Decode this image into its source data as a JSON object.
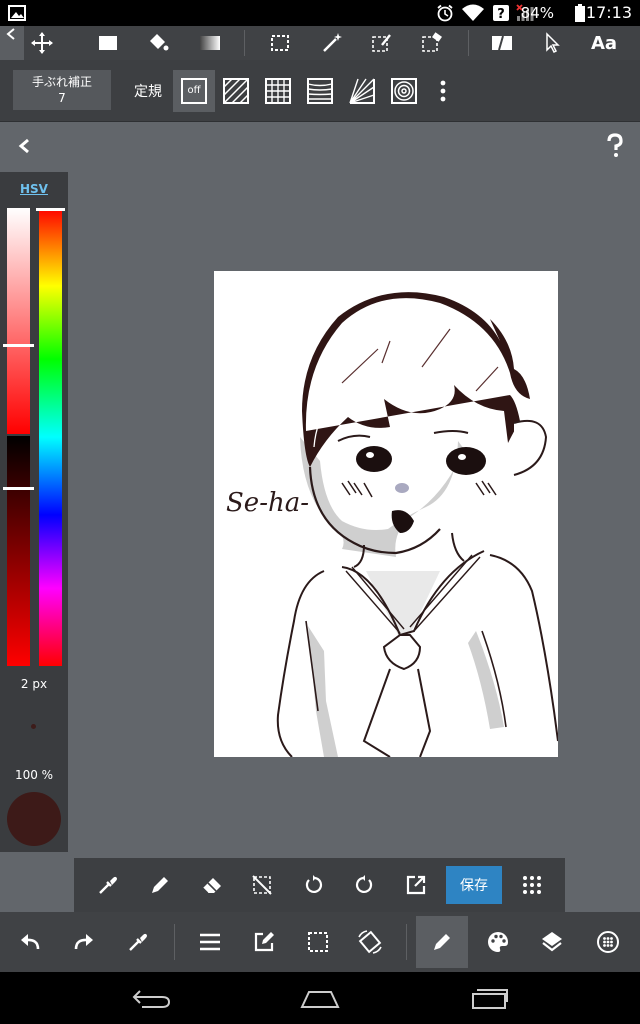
{
  "status_bar": {
    "battery": "84%",
    "time": "17:13",
    "icons": [
      "gallery-icon",
      "alarm-icon",
      "wifi-icon",
      "help-box-icon",
      "signal-off-icon",
      "battery-icon"
    ]
  },
  "top_toolbar": {
    "tools": [
      "move-icon",
      "fill-rect-icon",
      "bucket-icon",
      "gradient-icon",
      "select-rect-icon",
      "magic-wand-icon",
      "select-pen-icon",
      "select-eraser-icon",
      "frame-divider-icon",
      "pointer-icon",
      "text-icon"
    ],
    "text_tool_label": "Aa"
  },
  "ruler_bar": {
    "stabilizer_label": "手ぶれ補正",
    "stabilizer_value": "7",
    "ruler_label": "定規",
    "off_label": "off",
    "ruler_modes": [
      "ruler-off",
      "parallel-line-ruler",
      "grid-ruler",
      "perspective-ruler",
      "radial-ruler",
      "concentric-ruler"
    ]
  },
  "color_panel": {
    "mode_label": "HSV",
    "brush_size": "2 px",
    "opacity": "100 %",
    "current_color": "#3d1a18"
  },
  "canvas": {
    "handwritten_text": "Se-ha-"
  },
  "float_toolbar": {
    "tools": [
      "eyedropper-icon",
      "pen-icon",
      "eraser-icon",
      "deselect-icon",
      "rotate-left-icon",
      "rotate-right-icon",
      "export-icon"
    ],
    "save_label": "保存"
  },
  "bottom_toolbar": {
    "tools": [
      "undo-icon",
      "redo-icon",
      "eyedropper-icon",
      "menu-icon",
      "edit-icon",
      "selection-icon",
      "rotate-screen-icon",
      "brush-icon",
      "palette-icon",
      "layers-icon",
      "material-icon"
    ],
    "selected": "brush-icon"
  },
  "nav_bar": {
    "buttons": [
      "back-icon",
      "home-icon",
      "recents-icon"
    ]
  },
  "colors": {
    "accent": "#2e84c3",
    "hsv_link": "#6fc1ee",
    "workspace": "#62666b"
  }
}
